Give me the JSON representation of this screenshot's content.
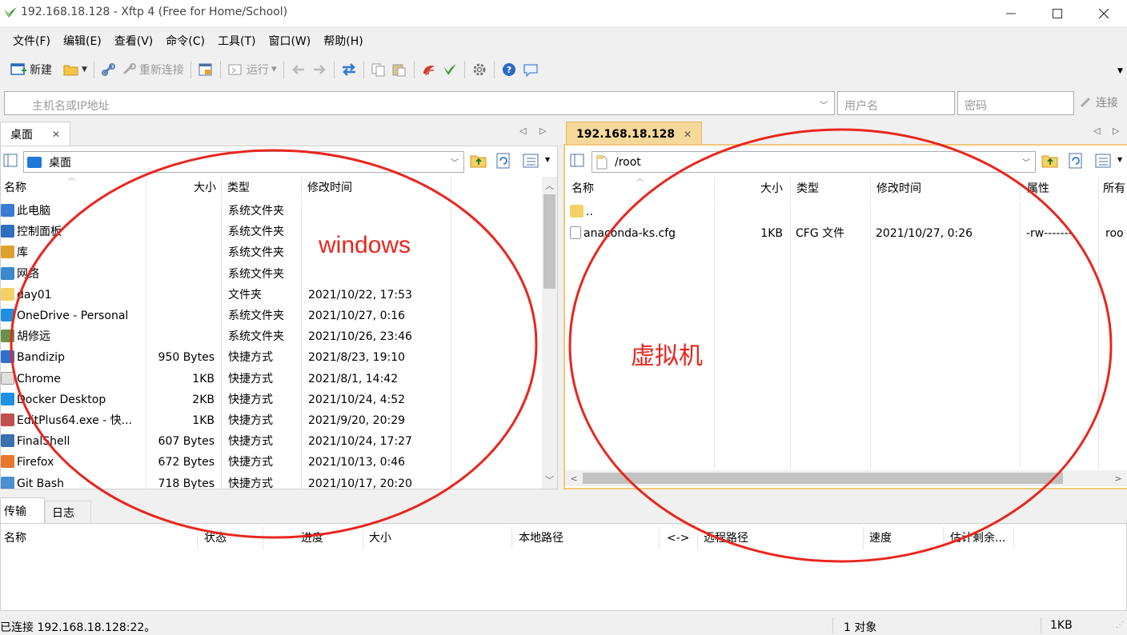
{
  "window": {
    "title": "192.168.18.128 - Xftp 4 (Free for Home/School)"
  },
  "menu": [
    "文件(F)",
    "编辑(E)",
    "查看(V)",
    "命令(C)",
    "工具(T)",
    "窗口(W)",
    "帮助(H)"
  ],
  "toolbar": {
    "new_label": "新建",
    "reconnect_label": "重新连接",
    "run_label": "运行"
  },
  "address": {
    "host_placeholder": "主机名或IP地址",
    "user_placeholder": "用户名",
    "password_placeholder": "密码",
    "connect_label": "连接"
  },
  "local": {
    "tab_label": "桌面",
    "path": "桌面",
    "columns": [
      "名称",
      "大小",
      "类型",
      "修改时间"
    ],
    "rows": [
      {
        "name": "此电脑",
        "size": "",
        "type": "系统文件夹",
        "modified": "",
        "icon": "pc-icon",
        "color": "#3a7bd5"
      },
      {
        "name": "控制面板",
        "size": "",
        "type": "系统文件夹",
        "modified": "",
        "icon": "control-panel-icon",
        "color": "#2f6fbf"
      },
      {
        "name": "库",
        "size": "",
        "type": "系统文件夹",
        "modified": "",
        "icon": "library-icon",
        "color": "#e0a030"
      },
      {
        "name": "网络",
        "size": "",
        "type": "系统文件夹",
        "modified": "",
        "icon": "network-icon",
        "color": "#3a8ad0"
      },
      {
        "name": "day01",
        "size": "",
        "type": "文件夹",
        "modified": "2021/10/22, 17:53",
        "icon": "folder-icon",
        "color": "#f5d067"
      },
      {
        "name": "OneDrive - Personal",
        "size": "",
        "type": "系统文件夹",
        "modified": "2021/10/27, 0:16",
        "icon": "onedrive-icon",
        "color": "#1f8fe0"
      },
      {
        "name": "胡修远",
        "size": "",
        "type": "系统文件夹",
        "modified": "2021/10/26, 23:46",
        "icon": "user-icon",
        "color": "#6a8f4f"
      },
      {
        "name": "Bandizip",
        "size": "950 Bytes",
        "type": "快捷方式",
        "modified": "2021/8/23, 19:10",
        "icon": "bandizip-icon",
        "color": "#2f6fd0"
      },
      {
        "name": "Chrome",
        "size": "1KB",
        "type": "快捷方式",
        "modified": "2021/8/1, 14:42",
        "icon": "chrome-icon",
        "color": "#e0e0e0"
      },
      {
        "name": "Docker Desktop",
        "size": "2KB",
        "type": "快捷方式",
        "modified": "2021/10/24, 4:52",
        "icon": "docker-icon",
        "color": "#1d91e6"
      },
      {
        "name": "EditPlus64.exe - 快...",
        "size": "1KB",
        "type": "快捷方式",
        "modified": "2021/9/20, 20:29",
        "icon": "editplus-icon",
        "color": "#c0504d"
      },
      {
        "name": "FinalShell",
        "size": "607 Bytes",
        "type": "快捷方式",
        "modified": "2021/10/24, 17:27",
        "icon": "finalshell-icon",
        "color": "#3a6fb0"
      },
      {
        "name": "Firefox",
        "size": "672 Bytes",
        "type": "快捷方式",
        "modified": "2021/10/13, 0:46",
        "icon": "firefox-icon",
        "color": "#e8762c"
      },
      {
        "name": "Git Bash",
        "size": "718 Bytes",
        "type": "快捷方式",
        "modified": "2021/10/17, 20:20",
        "icon": "git-icon",
        "color": "#4a8fd0"
      }
    ]
  },
  "remote": {
    "tab_label": "192.168.18.128",
    "path": "/root",
    "columns": [
      "名称",
      "大小",
      "类型",
      "修改时间",
      "属性",
      "所有"
    ],
    "rows": [
      {
        "name": "..",
        "size": "",
        "type": "",
        "modified": "",
        "attrs": "",
        "owner": "",
        "icon": "folder-icon",
        "color": "#f5d067"
      },
      {
        "name": "anaconda-ks.cfg",
        "size": "1KB",
        "type": "CFG 文件",
        "modified": "2021/10/27, 0:26",
        "attrs": "-rw-------",
        "owner": "roo",
        "icon": "file-icon",
        "color": "#ffffff"
      }
    ]
  },
  "transfer": {
    "tabs": [
      "传输",
      "日志"
    ],
    "columns": [
      "名称",
      "状态",
      "进度",
      "大小",
      "本地路径",
      "<->",
      "远程路径",
      "速度",
      "估计剩余..."
    ]
  },
  "status": {
    "connection": "已连接 192.168.18.128:22。",
    "objects": "1 对象",
    "size": "1KB"
  },
  "annotations": {
    "left_label": "windows",
    "right_label": "虚拟机",
    "color": "#e8261e"
  },
  "colors": {
    "accent_tab": "#f6d99a",
    "panel_border": "#e9c98a"
  }
}
